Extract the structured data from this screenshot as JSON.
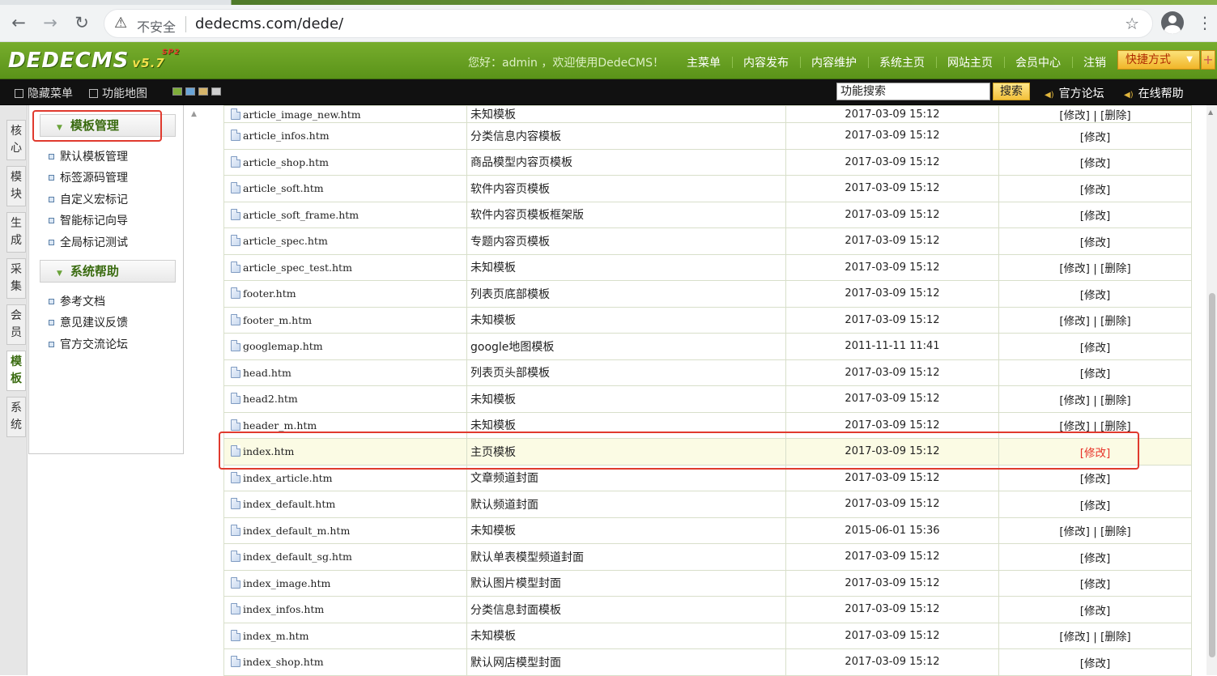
{
  "browser": {
    "back": "←",
    "forward": "→",
    "reload": "↻",
    "security_icon": "warning-triangle-icon",
    "insecure_label": "不安全",
    "url": "dedecms.com/dede/",
    "star": "☆",
    "menu": "⋮"
  },
  "header": {
    "logo": "DEDECMS",
    "version": "v5.7",
    "edition": "SP2",
    "welcome": "您好：admin ，欢迎使用DedeCMS！",
    "nav": [
      "主菜单",
      "内容发布",
      "内容维护",
      "系统主页",
      "网站主页",
      "会员中心",
      "注销"
    ],
    "quick_label": "快捷方式",
    "quick_arrow": "▼",
    "plus": "+"
  },
  "toolbar": {
    "hide_menu": "隐藏菜单",
    "func_map": "功能地图",
    "search_value": "功能搜索",
    "search_button": "搜索",
    "forum": "官方论坛",
    "help": "在线帮助",
    "link_mark": "◀)"
  },
  "sidetabs": [
    "核心",
    "模块",
    "生成",
    "采集",
    "会员",
    "模板",
    "系统"
  ],
  "active_tab": "模板",
  "leftpanel": {
    "section1": {
      "title": "模板管理",
      "items": [
        "默认模板管理",
        "标签源码管理",
        "自定义宏标记",
        "智能标记向导",
        "全局标记测试"
      ]
    },
    "section2": {
      "title": "系统帮助",
      "items": [
        "参考文档",
        "意见建议反馈",
        "官方交流论坛"
      ]
    },
    "triangle": "▼"
  },
  "table": {
    "partial_top": {
      "file": "article_image_new.htm",
      "desc": "未知模板",
      "date": "2017-03-09 15:12",
      "action": "[修改] | [删除]"
    },
    "rows": [
      {
        "file": "article_infos.htm",
        "desc": "分类信息内容模板",
        "date": "2017-03-09 15:12",
        "action": "[修改]"
      },
      {
        "file": "article_shop.htm",
        "desc": "商品模型内容页模板",
        "date": "2017-03-09 15:12",
        "action": "[修改]"
      },
      {
        "file": "article_soft.htm",
        "desc": "软件内容页模板",
        "date": "2017-03-09 15:12",
        "action": "[修改]"
      },
      {
        "file": "article_soft_frame.htm",
        "desc": "软件内容页模板框架版",
        "date": "2017-03-09 15:12",
        "action": "[修改]"
      },
      {
        "file": "article_spec.htm",
        "desc": "专题内容页模板",
        "date": "2017-03-09 15:12",
        "action": "[修改]"
      },
      {
        "file": "article_spec_test.htm",
        "desc": "未知模板",
        "date": "2017-03-09 15:12",
        "action": "[修改] | [删除]"
      },
      {
        "file": "footer.htm",
        "desc": "列表页底部模板",
        "date": "2017-03-09 15:12",
        "action": "[修改]"
      },
      {
        "file": "footer_m.htm",
        "desc": "未知模板",
        "date": "2017-03-09 15:12",
        "action": "[修改] | [删除]"
      },
      {
        "file": "googlemap.htm",
        "desc": "google地图模板",
        "date": "2011-11-11 11:41",
        "action": "[修改]"
      },
      {
        "file": "head.htm",
        "desc": "列表页头部模板",
        "date": "2017-03-09 15:12",
        "action": "[修改]"
      },
      {
        "file": "head2.htm",
        "desc": "未知模板",
        "date": "2017-03-09 15:12",
        "action": "[修改] | [删除]"
      },
      {
        "file": "header_m.htm",
        "desc": "未知模板",
        "date": "2017-03-09 15:12",
        "action": "[修改] | [删除]"
      },
      {
        "file": "index.htm",
        "desc": "主页模板",
        "date": "2017-03-09 15:12",
        "action": "[修改]",
        "highlight": true
      },
      {
        "file": "index_article.htm",
        "desc": "文章频道封面",
        "date": "2017-03-09 15:12",
        "action": "[修改]"
      },
      {
        "file": "index_default.htm",
        "desc": "默认频道封面",
        "date": "2017-03-09 15:12",
        "action": "[修改]"
      },
      {
        "file": "index_default_m.htm",
        "desc": "未知模板",
        "date": "2015-06-01 15:36",
        "action": "[修改] | [删除]"
      },
      {
        "file": "index_default_sg.htm",
        "desc": "默认单表模型频道封面",
        "date": "2017-03-09 15:12",
        "action": "[修改]"
      },
      {
        "file": "index_image.htm",
        "desc": "默认图片模型封面",
        "date": "2017-03-09 15:12",
        "action": "[修改]"
      },
      {
        "file": "index_infos.htm",
        "desc": "分类信息封面模板",
        "date": "2017-03-09 15:12",
        "action": "[修改]"
      },
      {
        "file": "index_m.htm",
        "desc": "未知模板",
        "date": "2017-03-09 15:12",
        "action": "[修改] | [删除]"
      },
      {
        "file": "index_shop.htm",
        "desc": "默认网店模型封面",
        "date": "2017-03-09 15:12",
        "action": "[修改]"
      }
    ]
  },
  "colors": {
    "header_green": "#5a9319",
    "highlight_red": "#e03a2e",
    "accent_yellow": "#f2c03b"
  }
}
